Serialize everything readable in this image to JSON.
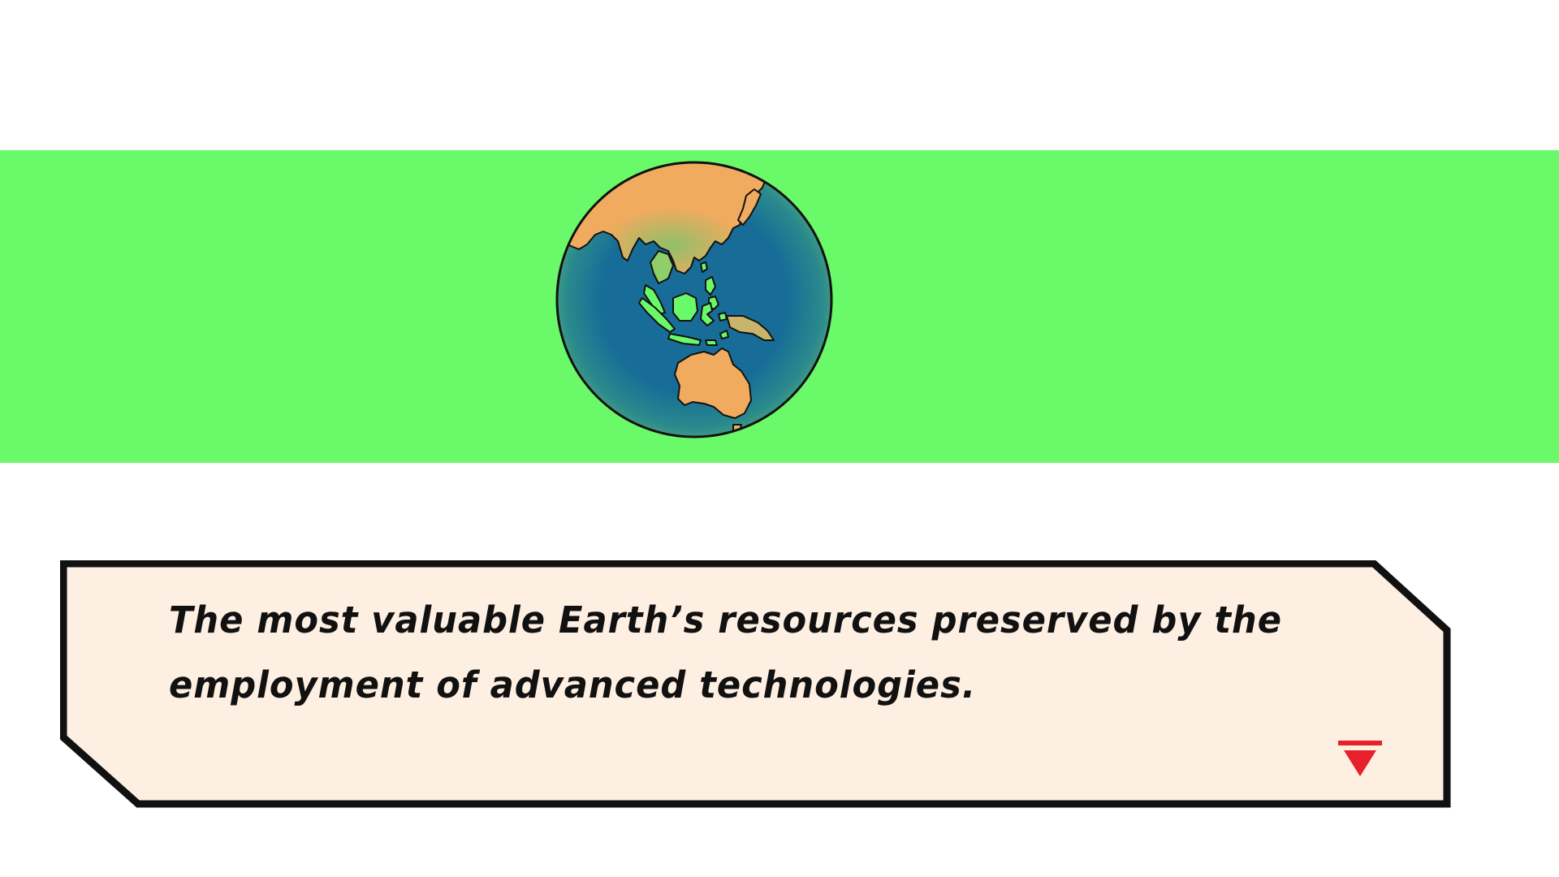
{
  "scene": {
    "background_color": "#ffffff",
    "band_color": "#6af968",
    "globe": {
      "icon": "earth-globe-icon",
      "ocean_color": "#1a6a94",
      "land_color": "#f0ab5e",
      "island_color": "#6af968",
      "outline_color": "#111111"
    }
  },
  "dialog": {
    "text": "The most valuable Earth’s resources preserved by the employment of advanced technologies.",
    "background_color": "#fdefe2",
    "border_color": "#111111",
    "advance_icon": "next-arrow-icon",
    "advance_color": "#e8202a"
  }
}
